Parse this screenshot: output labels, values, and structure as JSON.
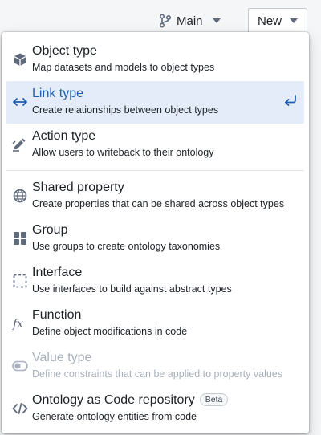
{
  "topbar": {
    "branch_label": "Main",
    "new_label": "New"
  },
  "menu": {
    "items": [
      {
        "title": "Object type",
        "description": "Map datasets and models to object types",
        "icon": "cube-icon"
      },
      {
        "title": "Link type",
        "description": "Create relationships between object types",
        "icon": "link-arrows-icon",
        "active": true
      },
      {
        "title": "Action type",
        "description": "Allow users to writeback to their ontology",
        "icon": "action-edit-icon"
      },
      {
        "title": "Shared property",
        "description": "Create properties that can be shared across object types",
        "icon": "globe-icon"
      },
      {
        "title": "Group",
        "description": "Use groups to create ontology taxonomies",
        "icon": "grid-icon"
      },
      {
        "title": "Interface",
        "description": "Use interfaces to build against abstract types",
        "icon": "dashed-square-icon"
      },
      {
        "title": "Function",
        "description": "Define object modifications in code",
        "icon": "function-icon"
      },
      {
        "title": "Value type",
        "description": "Define constraints that can be applied to property values",
        "icon": "toggle-icon",
        "disabled": true
      },
      {
        "title": "Ontology as Code repository",
        "description": "Generate ontology entities from code",
        "icon": "code-icon",
        "badge": "Beta"
      }
    ]
  },
  "colors": {
    "accent": "#215db0",
    "active_bg": "#e3ecf8",
    "icon": "#5f6b7c",
    "disabled": "#a7b0bb"
  }
}
